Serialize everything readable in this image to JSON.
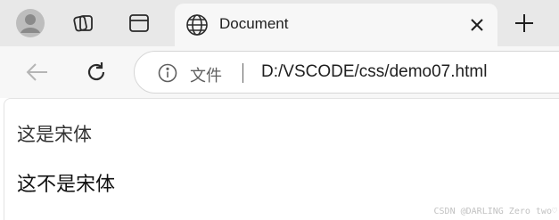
{
  "tabs": {
    "active_title": "Document"
  },
  "address_bar": {
    "scheme_label": "文件",
    "url": "D:/VSCODE/css/demo07.html"
  },
  "page": {
    "song_text": "这是宋体",
    "not_song_text": "这不是宋体"
  },
  "watermark": "CSDN @DARLING Zero two♡",
  "icons": [
    "profile-avatar-icon",
    "workspaces-icon",
    "tab-actions-icon",
    "globe-icon",
    "close-icon",
    "plus-icon",
    "back-arrow-icon",
    "refresh-icon",
    "info-icon"
  ]
}
